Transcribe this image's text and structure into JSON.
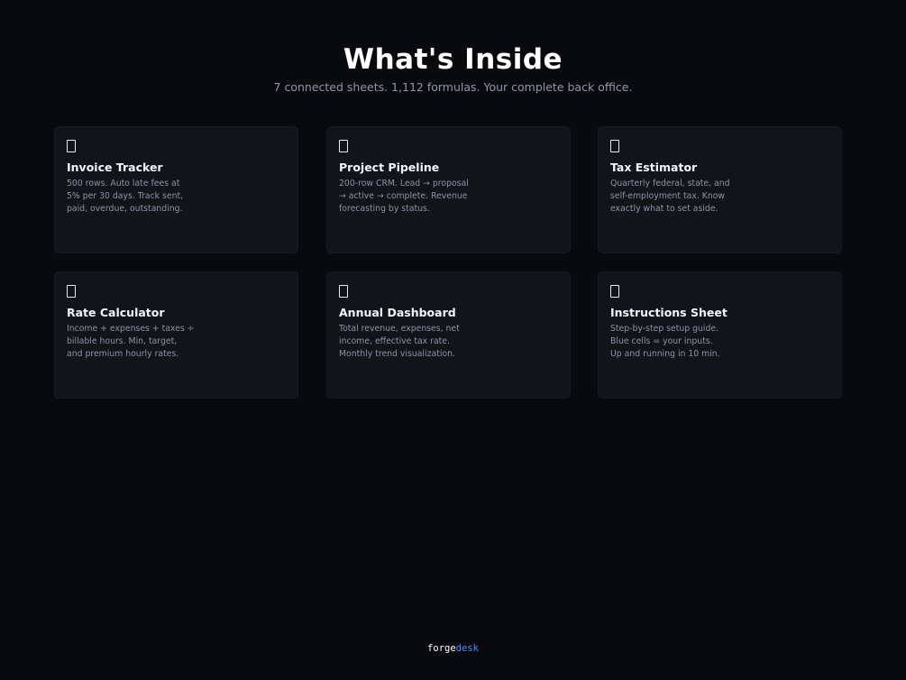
{
  "header": {
    "title": "What's Inside",
    "subtitle": "7 connected sheets. 1,112 formulas. Your complete back office."
  },
  "cards": [
    {
      "icon": "document-icon",
      "title": "Invoice Tracker",
      "desc_lines": [
        "500 rows. Auto late fees at",
        "5% per 30 days. Track sent,",
        "paid, overdue, outstanding."
      ]
    },
    {
      "icon": "document-icon",
      "title": "Project Pipeline",
      "desc_lines": [
        "200-row CRM. Lead → proposal",
        "→ active → complete. Revenue",
        "forecasting by status."
      ]
    },
    {
      "icon": "document-icon",
      "title": "Tax Estimator",
      "desc_lines": [
        "Quarterly federal, state, and",
        "self-employment tax. Know",
        "exactly what to set aside."
      ]
    },
    {
      "icon": "document-icon",
      "title": "Rate Calculator",
      "desc_lines": [
        "Income + expenses + taxes ÷",
        "billable hours. Min, target,",
        "and premium hourly rates."
      ]
    },
    {
      "icon": "document-icon",
      "title": "Annual Dashboard",
      "desc_lines": [
        "Total revenue, expenses, net",
        "income, effective tax rate.",
        "Monthly trend visualization."
      ]
    },
    {
      "icon": "document-icon",
      "title": "Instructions Sheet",
      "desc_lines": [
        "Step-by-step setup guide.",
        "Blue cells = your inputs.",
        "Up and running in 10 min."
      ]
    }
  ],
  "footer": {
    "brand_part1": "forge",
    "brand_part2": "desk"
  },
  "colors": {
    "background": "#090a0e",
    "card": "#121419",
    "accent": "#4d8df6"
  }
}
